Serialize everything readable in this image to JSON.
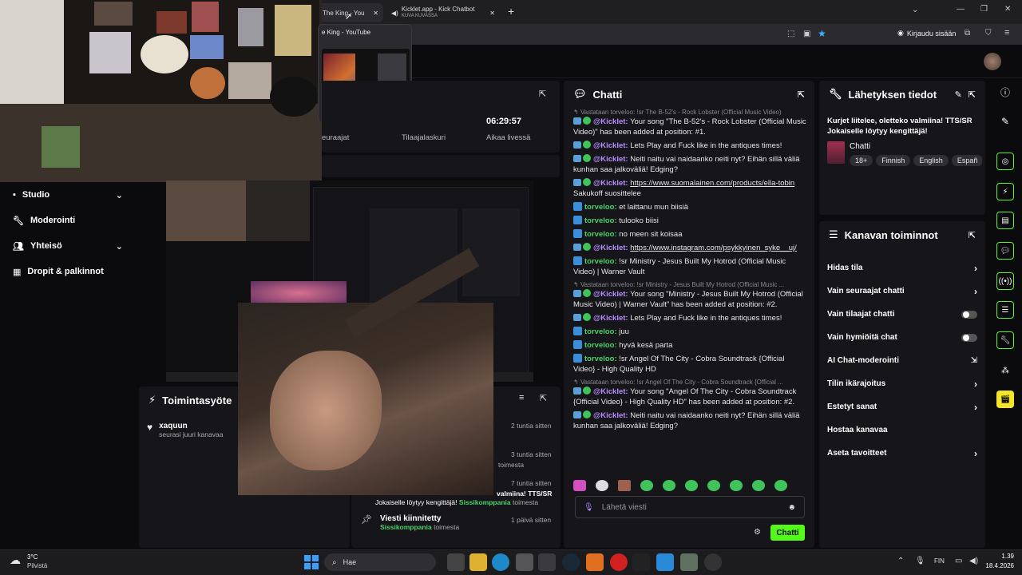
{
  "browser": {
    "tabs": [
      {
        "label": "The King - You"
      },
      {
        "label": "Kicklet.app - Kick Chatbot",
        "sub": "KUVA KUVASSA"
      }
    ],
    "new_tab": "+",
    "login_label": "Kirjaudu sisään"
  },
  "yt_preview": {
    "title": "e King - YouTube"
  },
  "stats": {
    "followers_label": "euraajat",
    "subs_label": "Tilaajalaskuri",
    "uptime_value": "06:29:57",
    "uptime_label": "Aikaa livessä"
  },
  "sidebar": {
    "items": [
      {
        "label": "Studio",
        "icon": "camera-icon"
      },
      {
        "label": "Moderointi",
        "icon": "wrench-icon"
      },
      {
        "label": "Yhteisö",
        "icon": "people-icon"
      },
      {
        "label": "Dropit & palkinnot",
        "icon": "chart-icon"
      }
    ]
  },
  "activity": {
    "title": "Toimintasyöte",
    "items": [
      {
        "user": "xaquun",
        "text": "seurasi juuri kanavaa"
      }
    ],
    "times": [
      "2 tuntia sitten",
      "3 tuntia sitten",
      "7 tuntia sitten",
      "1 päivä sitten"
    ],
    "toimesta_1": "toimesta",
    "partial_msg": "Jokaiselle löytyy kengittäjä!",
    "partial_msg_top": "valmiina! TTS/SR",
    "partial_user": "Sissikomppania",
    "pinned_title": "Viesti kiinnitetty",
    "pinned_user": "Sissikomppania",
    "pinned_suffix": "toimesta"
  },
  "chat": {
    "title": "Chatti",
    "input_placeholder": "Lähetä viesti",
    "send_label": "Chatti",
    "messages": [
      {
        "type": "reply",
        "text": "Vastataan torveloo: !sr The B-52's - Rock Lobster (Official Music Video)"
      },
      {
        "type": "bot",
        "user": "@Kicklet:",
        "text": "Your song \"The B-52's - Rock Lobster (Official Music Video)\" has been added at position: #1."
      },
      {
        "type": "bot",
        "user": "@Kicklet:",
        "text": "Lets Play and Fuck like in the antiques times!"
      },
      {
        "type": "bot",
        "user": "@Kicklet:",
        "text": "Neiti naitu vai naidaanko neiti nyt? Eihän sillä väliä kunhan saa jalkoväliä! Edging?"
      },
      {
        "type": "botlink",
        "user": "@Kicklet:",
        "link": "https://www.suomalainen.com/products/ella-tobin",
        "text": "Sakukoff suosittelee"
      },
      {
        "type": "user",
        "user": "torveloo:",
        "text": "et laittanu mun biisiä"
      },
      {
        "type": "user",
        "user": "torveloo:",
        "text": "tulooko biisi"
      },
      {
        "type": "user",
        "user": "torveloo:",
        "text": "no meen sit koisaa"
      },
      {
        "type": "botlink",
        "user": "@Kicklet:",
        "link": "https://www.instagram.com/psykkyinen_syke__uj/",
        "text": ""
      },
      {
        "type": "user",
        "user": "torveloo:",
        "text": "!sr Ministry - Jesus Built My Hotrod (Official Music Video) | Warner Vault"
      },
      {
        "type": "reply",
        "text": "Vastataan torveloo: !sr Ministry - Jesus Built My Hotrod (Official Music ..."
      },
      {
        "type": "bot",
        "user": "@Kicklet:",
        "text": "Your song \"Ministry - Jesus Built My Hotrod (Official Music Video) | Warner Vault\" has been added at position: #2."
      },
      {
        "type": "bot",
        "user": "@Kicklet:",
        "text": "Lets Play and Fuck like in the antiques times!"
      },
      {
        "type": "user",
        "user": "torveloo:",
        "text": "juu"
      },
      {
        "type": "user",
        "user": "torveloo:",
        "text": "hyvä kesä parta"
      },
      {
        "type": "user",
        "user": "torveloo:",
        "text": "!sr Angel Of The City - Cobra Soundtrack {Official Video} - High Quality HD"
      },
      {
        "type": "reply",
        "text": "Vastataan torveloo: !sr Angel Of The City - Cobra Soundtrack {Official ..."
      },
      {
        "type": "bot",
        "user": "@Kicklet:",
        "text": "Your song \"Angel Of The City - Cobra Soundtrack {Official Video} - High Quality HD\" has been added at position: #2."
      },
      {
        "type": "bot",
        "user": "@Kicklet:",
        "text": "Neiti naitu vai naidaanko neiti nyt? Eihän sillä väliä kunhan saa jalkoväliä! Edging?"
      }
    ]
  },
  "stream_info": {
    "title": "Lähetyksen tiedot",
    "stream_title": "Kurjet liitelee, oletteko valmiina! TTS/SR Jokaiselle löytyy kengittäjä!",
    "category": "Chatti",
    "tags": [
      "18+",
      "Finnish",
      "English",
      "Españ"
    ]
  },
  "channel_actions": {
    "title": "Kanavan toiminnot",
    "items": [
      {
        "label": "Hidas tila",
        "control": "chevron"
      },
      {
        "label": "Vain seuraajat chatti",
        "control": "chevron"
      },
      {
        "label": "Vain tilaajat chatti",
        "control": "toggle"
      },
      {
        "label": "Vain hymiöitä chat",
        "control": "toggle"
      },
      {
        "label": "AI Chat-moderointi",
        "control": "external"
      },
      {
        "label": "Tilin ikärajoitus",
        "control": "chevron"
      },
      {
        "label": "Estetyt sanat",
        "control": "chevron"
      },
      {
        "label": "Hostaa kanavaa",
        "control": "none"
      },
      {
        "label": "Aseta tavoitteet",
        "control": "chevron"
      }
    ]
  },
  "taskbar": {
    "weather_temp": "3°C",
    "weather_text": "Pilvistä",
    "search_label": "Hae",
    "lang": "FIN",
    "time": "1.39",
    "date": "18.4.2026"
  },
  "colors": {
    "accent": "#53fc18",
    "bot": "#b58cff",
    "user": "#49d16a"
  }
}
